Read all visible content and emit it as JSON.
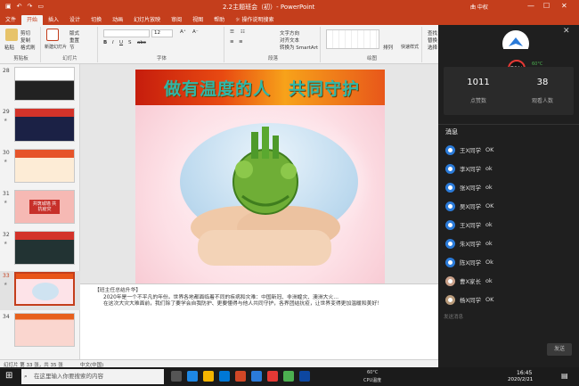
{
  "window": {
    "title": "2.2主题班会（初）- PowerPoint",
    "user": "曲 中权"
  },
  "ribbon_tabs": [
    "文件",
    "开始",
    "插入",
    "设计",
    "切换",
    "动画",
    "幻灯片放映",
    "审阅",
    "视图",
    "帮助"
  ],
  "ribbon_tab_tell": "操作说明搜索",
  "ribbon": {
    "paste": "粘贴",
    "cut": "剪切",
    "copy": "复制",
    "format_painter": "格式刷",
    "clipboard": "剪贴板",
    "new_slide": "新建幻灯片",
    "layout": "版式",
    "reset": "重置",
    "section": "节",
    "slides": "幻灯片",
    "font_group": "字体",
    "font_size": "12",
    "paragraph_group": "段落",
    "text_direction": "文字方向",
    "align_text": "对齐文本",
    "smartart": "转换为 SmartArt",
    "drawing_group": "绘图",
    "arrange": "排列",
    "quick_styles": "快速样式",
    "find": "查找",
    "replace": "替换",
    "select": "选择",
    "editing": "编辑"
  },
  "thumbnails": [
    {
      "num": "28"
    },
    {
      "num": "29"
    },
    {
      "num": "30"
    },
    {
      "num": "31",
      "text": "共筑城墙 共抗疫灾"
    },
    {
      "num": "32"
    },
    {
      "num": "33",
      "selected": true
    },
    {
      "num": "34"
    }
  ],
  "slide": {
    "banner_text": "做有温度的人　共同守护"
  },
  "notes": {
    "heading": "【班主任总结升华】",
    "p1": "2020年是一个不平凡的年份。世界各地都面临着不同的疾病和灾难：中国新冠、非洲蝗灾、澳洲大火…",
    "p2": "在这次大灾大难面前，我们除了要学会自我防护、更要懂得与他人共同守护，各界团结抗疫，让世界变得更加温暖和美好！"
  },
  "status": {
    "slide_info": "幻灯片 第 33 张，共 35 张",
    "lang": "中文(中国)",
    "zoom": "77%"
  },
  "live": {
    "likes_value": "1011",
    "likes_label": "点赞数",
    "viewers_value": "38",
    "viewers_label": "观看人数",
    "cpu_percent": "78%",
    "cpu_temp": "60°C",
    "cpu_label": "CPU温度",
    "messages_title": "消息",
    "messages": [
      {
        "name": "王X同学",
        "text": "OK"
      },
      {
        "name": "李X同学",
        "text": "ok"
      },
      {
        "name": "张X同学",
        "text": "ok"
      },
      {
        "name": "吴X同学",
        "text": "OK"
      },
      {
        "name": "王X同学",
        "text": "ok"
      },
      {
        "name": "朱X同学",
        "text": "ok"
      },
      {
        "name": "陈X同学",
        "text": "Ok"
      },
      {
        "name": "曹X家长",
        "text": "ok"
      },
      {
        "name": "杨X同学",
        "text": "OK"
      }
    ],
    "input_placeholder": "发送消息",
    "send_label": "发送"
  },
  "taskbar": {
    "search_placeholder": "在这里输入你要搜索的内容",
    "temp": "60°C",
    "temp_label": "CPU温度",
    "time": "16:45",
    "date": "2020/2/21"
  },
  "colors": {
    "accent": "#c43e1c",
    "panel_bg": "#1f1f1f",
    "taskbar": "#1b1b1b"
  }
}
